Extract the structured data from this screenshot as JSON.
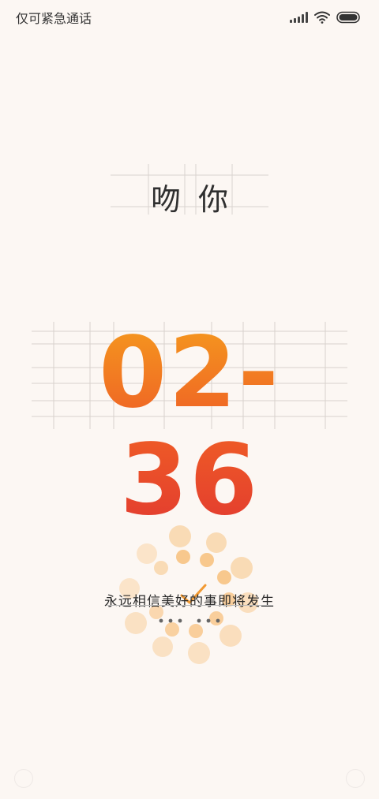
{
  "status_bar": {
    "carrier": "仅可紧急通话",
    "signal_icon": "signal-icon",
    "wifi_icon": "wifi-icon",
    "battery_icon": "battery-icon"
  },
  "lock_screen": {
    "title": "吻你",
    "clock": "02-36",
    "motto": "永远相信美好的事即将发生",
    "accent_colors": [
      "#f59a1e",
      "#ee5a26",
      "#e23a30"
    ],
    "background": "#fcf7f3"
  },
  "corners": {
    "left_icon": "camera-icon",
    "right_icon": "flashlight-icon"
  }
}
